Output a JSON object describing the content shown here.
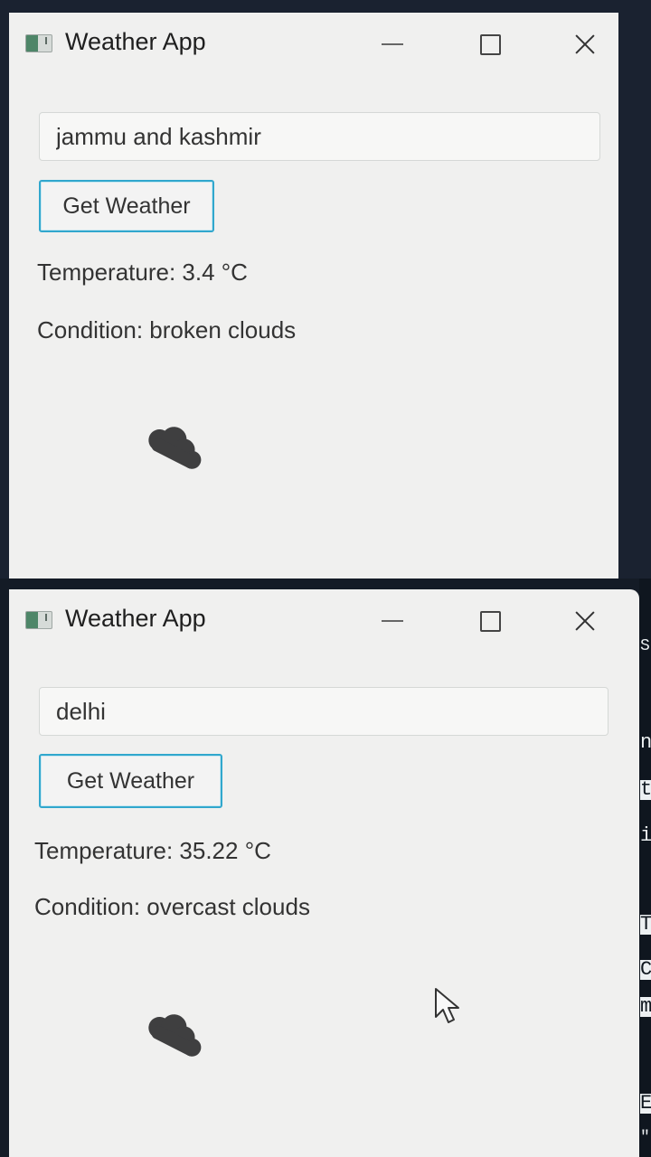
{
  "screens": [
    {
      "app_title": "Weather App",
      "city_input": {
        "value": "jammu and kashmir"
      },
      "get_weather_label": "Get Weather",
      "temperature_text": "Temperature: 3.4 °C",
      "condition_text": "Condition: broken clouds",
      "weather_icon": "broken-clouds-icon"
    },
    {
      "app_title": "Weather App",
      "city_input": {
        "value": "delhi"
      },
      "get_weather_label": "Get Weather",
      "temperature_text": "Temperature: 35.22 °C",
      "condition_text": "Condition: overcast clouds",
      "weather_icon": "overcast-clouds-icon",
      "cursor_icon": "mouse-cursor-icon",
      "background_edge_text": [
        "S",
        "n",
        "t",
        "i",
        "T",
        "C",
        "m",
        "E",
        "\""
      ]
    }
  ],
  "window_controls": {
    "minimize_icon": "minimize-icon",
    "maximize_icon": "maximize-icon",
    "close_icon": "close-icon"
  },
  "colors": {
    "window_bg": "#f0f0ef",
    "accent": "#31a7cd",
    "text": "#333333",
    "weather_icon": "#3f3f40"
  }
}
